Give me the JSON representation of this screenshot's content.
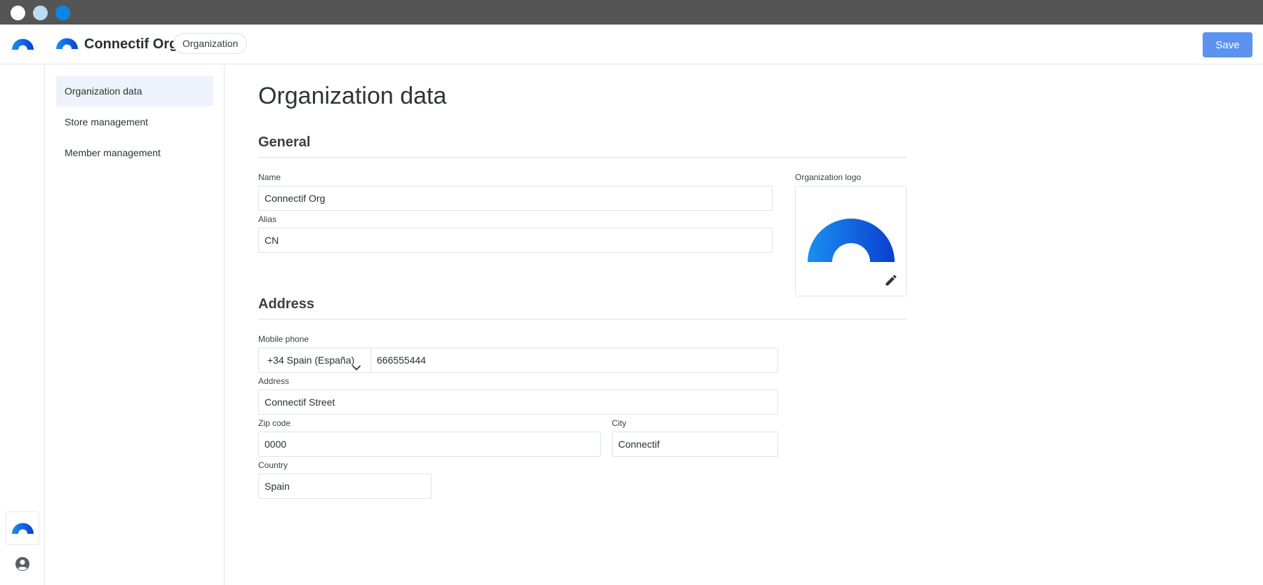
{
  "window": {
    "controls": [
      "close",
      "minimize",
      "maximize"
    ]
  },
  "header": {
    "org_name": "Connectif Org",
    "badge": "Organization",
    "save_label": "Save"
  },
  "colors": {
    "accent": "#5b93ef",
    "logo_gradient_start": "#1a8ff0",
    "logo_gradient_end": "#0a3fd0",
    "active_nav_bg": "#eef3fb"
  },
  "icons": {
    "rail_logo": "connectif-arc-icon",
    "user": "account-circle-icon",
    "edit": "pencil-icon",
    "dropdown": "chevron-down-icon"
  },
  "subnav": {
    "items": [
      {
        "label": "Organization data",
        "active": true
      },
      {
        "label": "Store management",
        "active": false
      },
      {
        "label": "Member management",
        "active": false
      }
    ]
  },
  "main": {
    "title": "Organization data",
    "general": {
      "title": "General",
      "name_label": "Name",
      "name_value": "Connectif Org",
      "alias_label": "Alias",
      "alias_value": "CN",
      "logo_label": "Organization logo"
    },
    "address": {
      "title": "Address",
      "phone_label": "Mobile phone",
      "phone_country": "+34 Spain (España)",
      "phone_value": "666555444",
      "address_label": "Address",
      "address_value": "Connectif Street",
      "zip_label": "Zip code",
      "zip_value": "0000",
      "city_label": "City",
      "city_value": "Connectif",
      "country_label": "Country",
      "country_value": "Spain"
    }
  }
}
